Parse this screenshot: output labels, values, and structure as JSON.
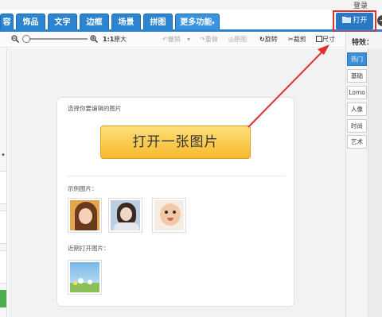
{
  "header": {
    "login_label": "登录",
    "open_button_label": "打开",
    "tabs": [
      {
        "label": "容"
      },
      {
        "label": "饰品"
      },
      {
        "label": "文字"
      },
      {
        "label": "边框"
      },
      {
        "label": "场景"
      },
      {
        "label": "拼图"
      },
      {
        "label": "更多功能"
      }
    ]
  },
  "toolbar": {
    "zoom_ratio": "1:1",
    "original_size_label": "原大",
    "undo_label": "撤销",
    "redo_label": "重做",
    "reset_label": "原图",
    "rotate_label": "旋转",
    "crop_label": "裁剪",
    "resize_label": "尺寸"
  },
  "panel": {
    "choose_label": "选择你要编辑的图片",
    "open_image_label": "打开一张图片",
    "sample_label": "示例图片：",
    "recent_label": "近期打开图片："
  },
  "effects": {
    "title": "特效：",
    "categories": [
      {
        "label": "热门"
      },
      {
        "label": "基础"
      },
      {
        "label": "Lomo"
      },
      {
        "label": "人像"
      },
      {
        "label": "时尚"
      },
      {
        "label": "艺术"
      }
    ],
    "active_index": 0
  },
  "colors": {
    "tab_blue": "#2d84d0",
    "open_button_blue": "#2a78c4",
    "highlight_red": "#e03030",
    "open_image_yellow": "#f6b92c"
  }
}
